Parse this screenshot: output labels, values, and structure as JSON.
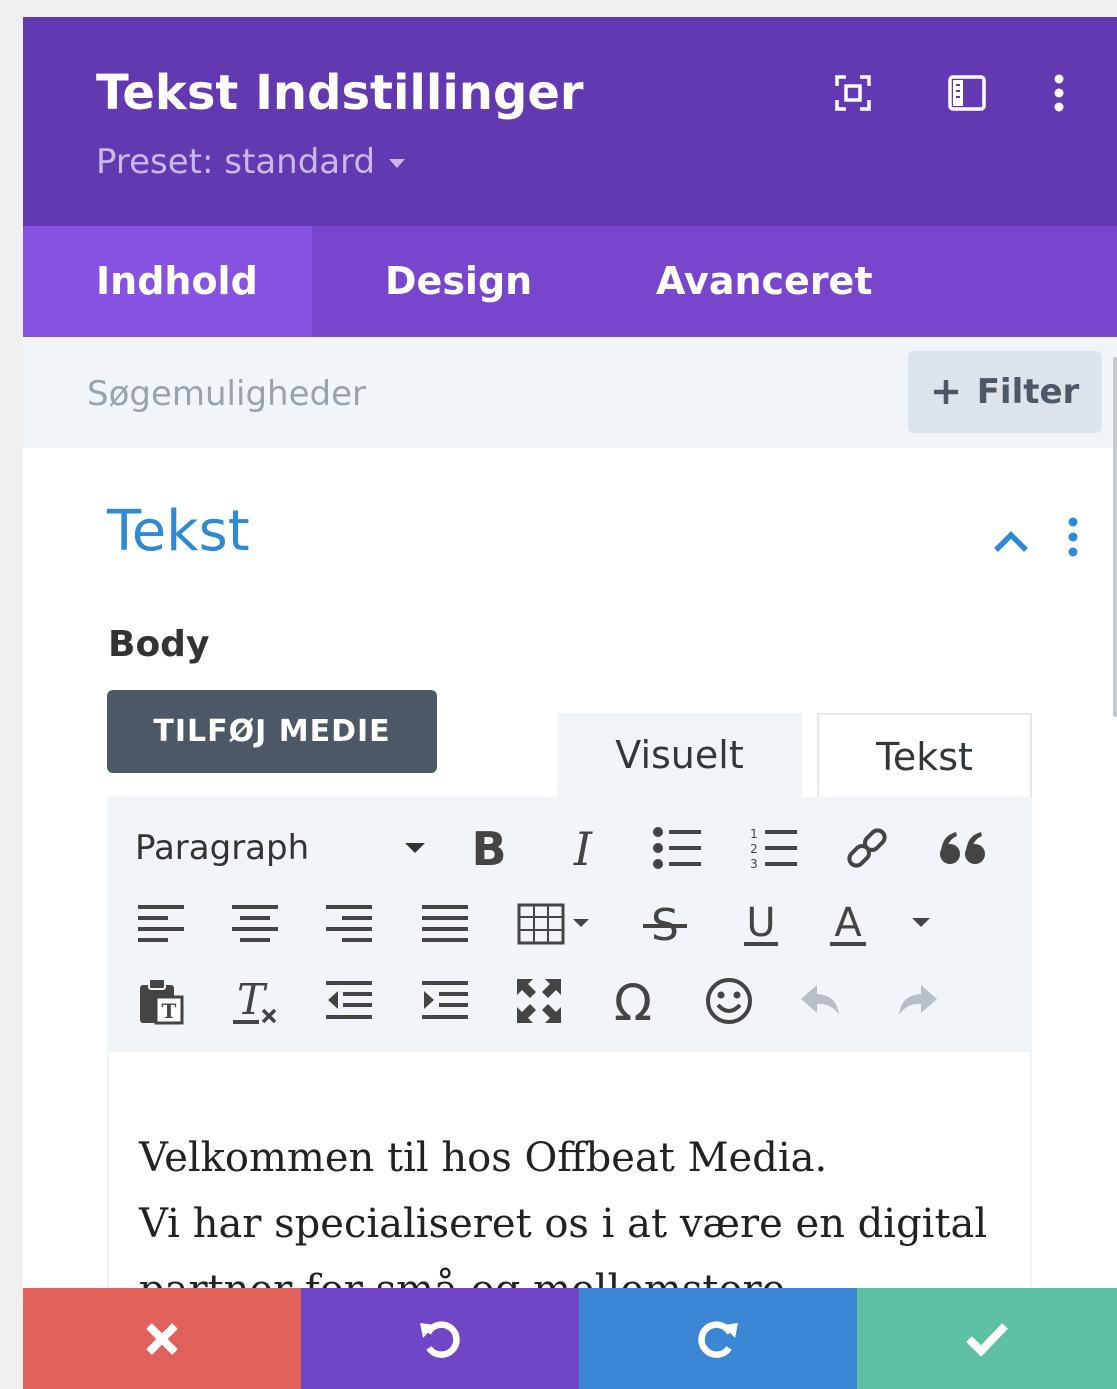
{
  "header": {
    "title": "Tekst Indstillinger",
    "preset_label": "Preset: standard",
    "icons": [
      "expand-icon",
      "sidebar-icon",
      "more-icon"
    ]
  },
  "tabs": [
    {
      "label": "Indhold",
      "active": true
    },
    {
      "label": "Design",
      "active": false
    },
    {
      "label": "Avanceret",
      "active": false
    }
  ],
  "search": {
    "placeholder": "Søgemuligheder",
    "value": "",
    "filter_label": "Filter"
  },
  "section": {
    "title": "Tekst",
    "field_label": "Body",
    "add_media_label": "TILFØJ MEDIE"
  },
  "editor": {
    "tabs": {
      "visual": "Visuelt",
      "text": "Tekst",
      "active": "visual"
    },
    "format_value": "Paragraph",
    "toolbar_row1": [
      "bold-icon",
      "italic-icon",
      "bullet-list-icon",
      "numbered-list-icon",
      "link-icon",
      "blockquote-icon"
    ],
    "toolbar_row2": [
      "align-left-icon",
      "align-center-icon",
      "align-right-icon",
      "justify-icon",
      "table-icon",
      "strikethrough-icon",
      "underline-icon",
      "text-color-icon"
    ],
    "toolbar_row3": [
      "paste-text-icon",
      "clear-format-icon",
      "outdent-icon",
      "indent-icon",
      "fullscreen-icon",
      "special-char-icon",
      "emoji-icon",
      "undo-icon",
      "redo-icon"
    ],
    "content_lines": [
      "Velkommen til hos Offbeat Media.",
      "Vi har specialiseret os i at være en digital",
      "partner for små og mellemstore"
    ]
  },
  "footer": {
    "buttons": [
      "discard",
      "undo",
      "redo",
      "save"
    ]
  },
  "colors": {
    "header": "#6239b1",
    "tabs": "#7846cc",
    "active_tab": "#8752e2",
    "section_title": "#2f8ad6",
    "discard": "#e0605c",
    "undo": "#7046c6",
    "redo": "#3b87d6",
    "save": "#5dc0a4"
  }
}
